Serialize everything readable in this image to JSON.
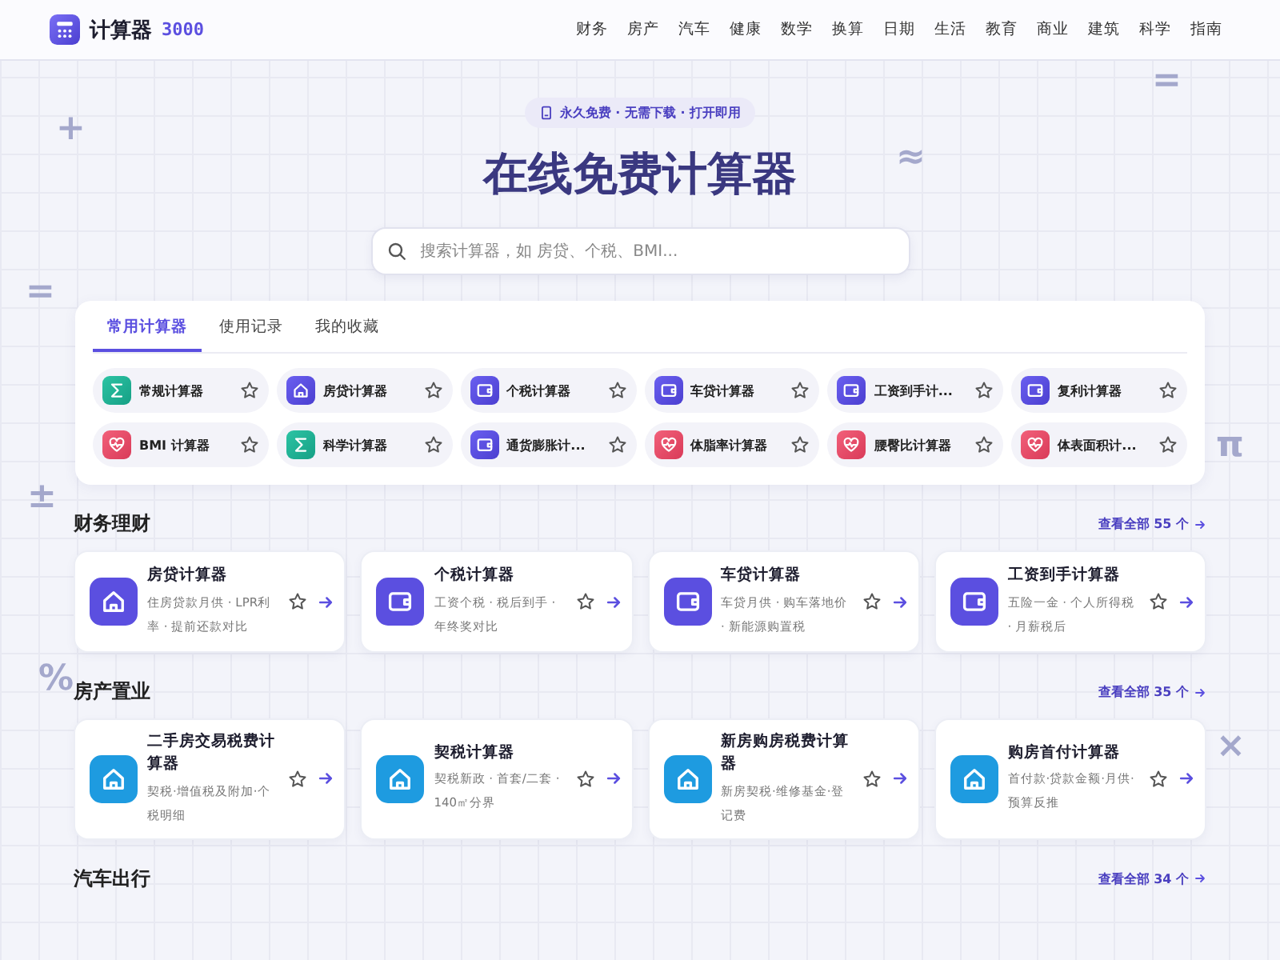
{
  "header": {
    "logo": "计算器",
    "logo_suffix": "3000",
    "nav": [
      "财务",
      "房产",
      "汽车",
      "健康",
      "数学",
      "换算",
      "日期",
      "生活",
      "教育",
      "商业",
      "建筑",
      "科学",
      "指南"
    ]
  },
  "decorations": [
    "+",
    "=",
    "≈",
    "=",
    "±",
    "%",
    "π",
    "×"
  ],
  "hero": {
    "badge": "永久免费 · 无需下载 · 打开即用",
    "title": "在线免费计算器",
    "search": {
      "placeholder": "搜索计算器，如 房贷、个税、BMI..."
    }
  },
  "tabs": [
    {
      "label": "常用计算器",
      "selected": true
    },
    {
      "label": "使用记录",
      "selected": false
    },
    {
      "label": "我的收藏",
      "selected": false
    }
  ],
  "quick": [
    {
      "kind": "sigma",
      "label": "常规计算器",
      "favorite": false
    },
    {
      "kind": "home",
      "label": "房贷计算器",
      "favorite": false
    },
    {
      "kind": "wallet",
      "label": "个税计算器",
      "favorite": false
    },
    {
      "kind": "wallet",
      "label": "车贷计算器",
      "favorite": false
    },
    {
      "kind": "wallet",
      "label": "工资到手计...",
      "favorite": false
    },
    {
      "kind": "wallet",
      "label": "复利计算器",
      "favorite": false
    },
    {
      "kind": "heart",
      "label": "BMI 计算器",
      "favorite": false
    },
    {
      "kind": "sigma",
      "label": "科学计算器",
      "favorite": false
    },
    {
      "kind": "wallet",
      "label": "通货膨胀计...",
      "favorite": false
    },
    {
      "kind": "heart",
      "label": "体脂率计算器",
      "favorite": false
    },
    {
      "kind": "heart",
      "label": "腰臀比计算器",
      "favorite": false
    },
    {
      "kind": "heart",
      "label": "体表面积计...",
      "favorite": false
    }
  ],
  "sections": [
    {
      "title": "财务理财",
      "more": "查看全部 55 个",
      "cards": [
        {
          "kind": "home",
          "color": "#5b4fe0",
          "title": "房贷计算器",
          "desc": "住房贷款月供 · LPR利率 · 提前还款对比"
        },
        {
          "kind": "wallet",
          "color": "#5b4fe0",
          "title": "个税计算器",
          "desc": "工资个税 · 税后到手 · 年终奖对比"
        },
        {
          "kind": "wallet",
          "color": "#5b4fe0",
          "title": "车贷计算器",
          "desc": "车贷月供 · 购车落地价 · 新能源购置税"
        },
        {
          "kind": "wallet",
          "color": "#5b4fe0",
          "title": "工资到手计算器",
          "desc": "五险一金 · 个人所得税 · 月薪税后"
        }
      ]
    },
    {
      "title": "房产置业",
      "more": "查看全部 35 个",
      "cards": [
        {
          "kind": "home",
          "color": "#1e9be0",
          "title": "二手房交易税费计算器",
          "desc": "契税·增值税及附加·个税明细"
        },
        {
          "kind": "home",
          "color": "#1e9be0",
          "title": "契税计算器",
          "desc": "契税新政 · 首套/二套 · 140㎡分界"
        },
        {
          "kind": "home",
          "color": "#1e9be0",
          "title": "新房购房税费计算器",
          "desc": "新房契税·维修基金·登记费"
        },
        {
          "kind": "home",
          "color": "#1e9be0",
          "title": "购房首付计算器",
          "desc": "首付款·贷款金额·月供·预算反推"
        }
      ]
    },
    {
      "title": "汽车出行",
      "more": "查看全部 34 个"
    }
  ]
}
